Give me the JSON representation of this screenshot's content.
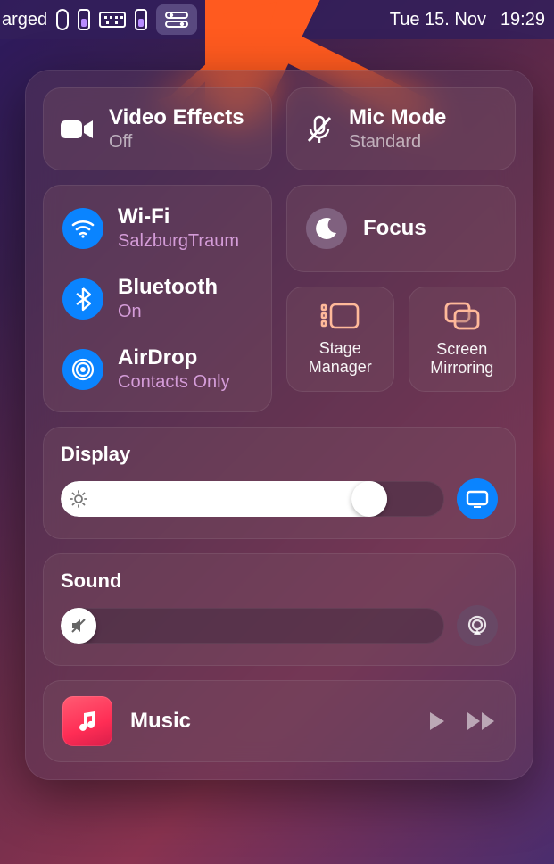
{
  "menubar": {
    "charged_text": "arged",
    "date": "Tue 15. Nov",
    "time": "19:29"
  },
  "video_effects": {
    "title": "Video Effects",
    "status": "Off"
  },
  "mic_mode": {
    "title": "Mic Mode",
    "status": "Standard"
  },
  "wifi": {
    "title": "Wi-Fi",
    "status": "SalzburgTraum"
  },
  "bluetooth": {
    "title": "Bluetooth",
    "status": "On"
  },
  "airdrop": {
    "title": "AirDrop",
    "status": "Contacts Only"
  },
  "focus": {
    "title": "Focus"
  },
  "stage_manager": {
    "label": "Stage Manager"
  },
  "screen_mirroring": {
    "label": "Screen Mirroring"
  },
  "display": {
    "label": "Display",
    "value_pct": 85
  },
  "sound": {
    "label": "Sound",
    "value_pct": 0
  },
  "music": {
    "title": "Music"
  }
}
